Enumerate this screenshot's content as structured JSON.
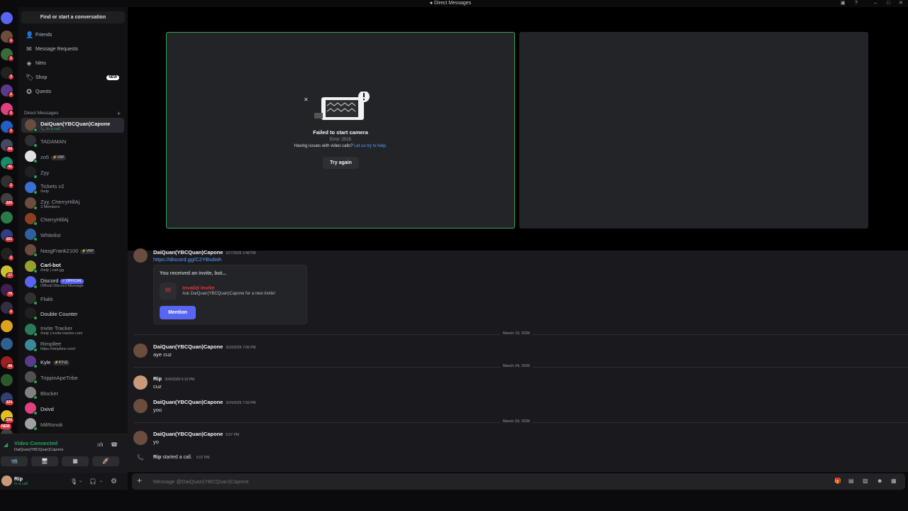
{
  "window": {
    "title": "Direct Messages"
  },
  "servers": [
    {
      "color": "#5865f2",
      "badge": ""
    },
    {
      "color": "#6b4d3d",
      "badge": "1"
    },
    {
      "color": "#3a6b3a",
      "badge": "1"
    },
    {
      "color": "#222222",
      "badge": "3"
    },
    {
      "color": "#5a3a8a",
      "badge": "2"
    },
    {
      "color": "#e04080",
      "badge": "1"
    },
    {
      "color": "#2060c0",
      "badge": "1"
    },
    {
      "color": "#444a60",
      "badge": "54"
    },
    {
      "color": "#1a8a6a",
      "badge": "41"
    },
    {
      "color": "#303030",
      "badge": "2"
    },
    {
      "color": "#404040",
      "badge": "220"
    },
    {
      "color": "#2a7a4a",
      "badge": ""
    },
    {
      "color": "#304080",
      "badge": "161"
    },
    {
      "color": "#222222",
      "badge": "2"
    },
    {
      "color": "#d0c030",
      "badge": "17"
    },
    {
      "color": "#402050",
      "badge": "79"
    },
    {
      "color": "#303040",
      "badge": "2"
    },
    {
      "color": "#e0a020",
      "badge": ""
    },
    {
      "color": "#306090",
      "badge": ""
    },
    {
      "color": "#a02020",
      "badge": "98"
    },
    {
      "color": "#2a5a2a",
      "badge": ""
    },
    {
      "color": "#304070",
      "badge": "329"
    },
    {
      "color": "#e0c020",
      "badge": "358"
    },
    {
      "color": "#404040",
      "badge": ""
    }
  ],
  "new_badge": "NEW",
  "sidebar": {
    "find": "Find or start a conversation",
    "nav": [
      {
        "label": "Friends",
        "icon": "👤"
      },
      {
        "label": "Message Requests",
        "icon": "✉"
      },
      {
        "label": "Nitro",
        "icon": "◈"
      },
      {
        "label": "Shop",
        "icon": "🏷"
      },
      {
        "label": "Quests",
        "icon": "✪"
      }
    ],
    "shop_badge": "NEW",
    "dm_header": "Direct Messages",
    "dms": [
      {
        "name": "DaiQuan(YBCQuan)Capone",
        "sub": "📞 In a call",
        "color": "#6b4d3d",
        "style": "bright",
        "tag": ""
      },
      {
        "name": "TADAMAN",
        "sub": "",
        "color": "#303030",
        "style": "",
        "tag": ""
      },
      {
        "name": "zo5",
        "sub": "",
        "color": "#e0e0e0",
        "style": "",
        "tag": "⚡VRP"
      },
      {
        "name": "Zyy",
        "sub": "",
        "color": "#202020",
        "style": "",
        "tag": ""
      },
      {
        "name": "Tickets v2",
        "sub": "/help",
        "color": "#3a70d0",
        "style": "",
        "tag": ""
      },
      {
        "name": "Zyy, CherryHillAj",
        "sub": "3 Members",
        "color": "#6b4d3d",
        "style": "",
        "tag": ""
      },
      {
        "name": "CherryHillAj",
        "sub": "",
        "color": "#8a4020",
        "style": "",
        "tag": ""
      },
      {
        "name": "Whitelist",
        "sub": "",
        "color": "#3060a0",
        "style": "",
        "tag": ""
      },
      {
        "name": "NasgFrank2100",
        "sub": "",
        "color": "#6a4a3a",
        "style": "",
        "tag": "⚡VRP"
      },
      {
        "name": "Carl-bot",
        "sub": "/help | carl.gg",
        "color": "#9aa030",
        "style": "bright",
        "tag": ""
      },
      {
        "name": "Discord",
        "sub": "Official Discord Message",
        "color": "#5865f2",
        "style": "white",
        "tag": "✓ OFFICIAL"
      },
      {
        "name": "Flakk",
        "sub": "",
        "color": "#303030",
        "style": "",
        "tag": ""
      },
      {
        "name": "Double Counter",
        "sub": "",
        "color": "#202020",
        "style": "white",
        "tag": ""
      },
      {
        "name": "Invite Tracker",
        "sub": "/help | invite-tracker.com",
        "color": "#2a7a5a",
        "style": "",
        "tag": ""
      },
      {
        "name": "Rimpllee",
        "sub": "https://rimpllee.com/",
        "color": "#3a8a9a",
        "style": "",
        "tag": ""
      },
      {
        "name": "Kyle",
        "sub": "",
        "color": "#5a3a8a",
        "style": "white",
        "tag": "⚡KYLE"
      },
      {
        "name": "TrippinApeTribe",
        "sub": "",
        "color": "#505055",
        "style": "",
        "tag": ""
      },
      {
        "name": "Blocker",
        "sub": "",
        "color": "#808085",
        "style": "",
        "tag": ""
      },
      {
        "name": "Dxivd",
        "sub": "",
        "color": "#e04080",
        "style": "white",
        "tag": ""
      },
      {
        "name": "MilRonok",
        "sub": "",
        "color": "#a0a0a5",
        "style": "",
        "tag": ""
      }
    ]
  },
  "voice": {
    "status": "Video Connected",
    "channel": "DaiQuan(YBCQuan)Capone",
    "buttons": [
      "📹",
      "🖥",
      "▦",
      "🚀"
    ]
  },
  "user": {
    "name": "Rip",
    "status": "In a call"
  },
  "video": {
    "error_title": "Failed to start camera",
    "error_code": "Error: 2015",
    "help_text": "Having issues with video calls?",
    "help_link": "Let us try to help.",
    "try_again": "Try again"
  },
  "chat": {
    "top_msg": {
      "author": "DaiQuan(YBCQuan)Capone",
      "time": "3/17/2026 3:48 PM",
      "link": "https://discord.gg/C2YBsdwh"
    },
    "invite": {
      "header": "You received an invite, but...",
      "title": "Invalid Invite",
      "desc": "Ask DaiQuan(YBCQuan)Capone for a new invite!",
      "button": "Mention"
    },
    "dates": [
      "March 19, 2026",
      "March 24, 2026",
      "March 29, 2026"
    ],
    "messages": [
      {
        "author": "DaiQuan(YBCQuan)Capone",
        "time": "3/19/2026 7:06 PM",
        "text": "aye cuz"
      },
      {
        "author": "Rip",
        "time": "3/24/2026 6:10 PM",
        "text": "cuz"
      },
      {
        "author": "DaiQuan(YBCQuan)Capone",
        "time": "3/24/2026 7:59 PM",
        "text": "yoo"
      },
      {
        "author": "DaiQuan(YBCQuan)Capone",
        "time": "5:07 PM",
        "text": "yo"
      }
    ],
    "call": {
      "author": "Rip",
      "text": "started a call.",
      "time": "5:07 PM"
    }
  },
  "composer": {
    "placeholder": "Message @DaiQuan(YBCQuan)Capone"
  },
  "colors": {
    "accent": "#5865f2",
    "green": "#23a55a",
    "red": "#da373c"
  }
}
